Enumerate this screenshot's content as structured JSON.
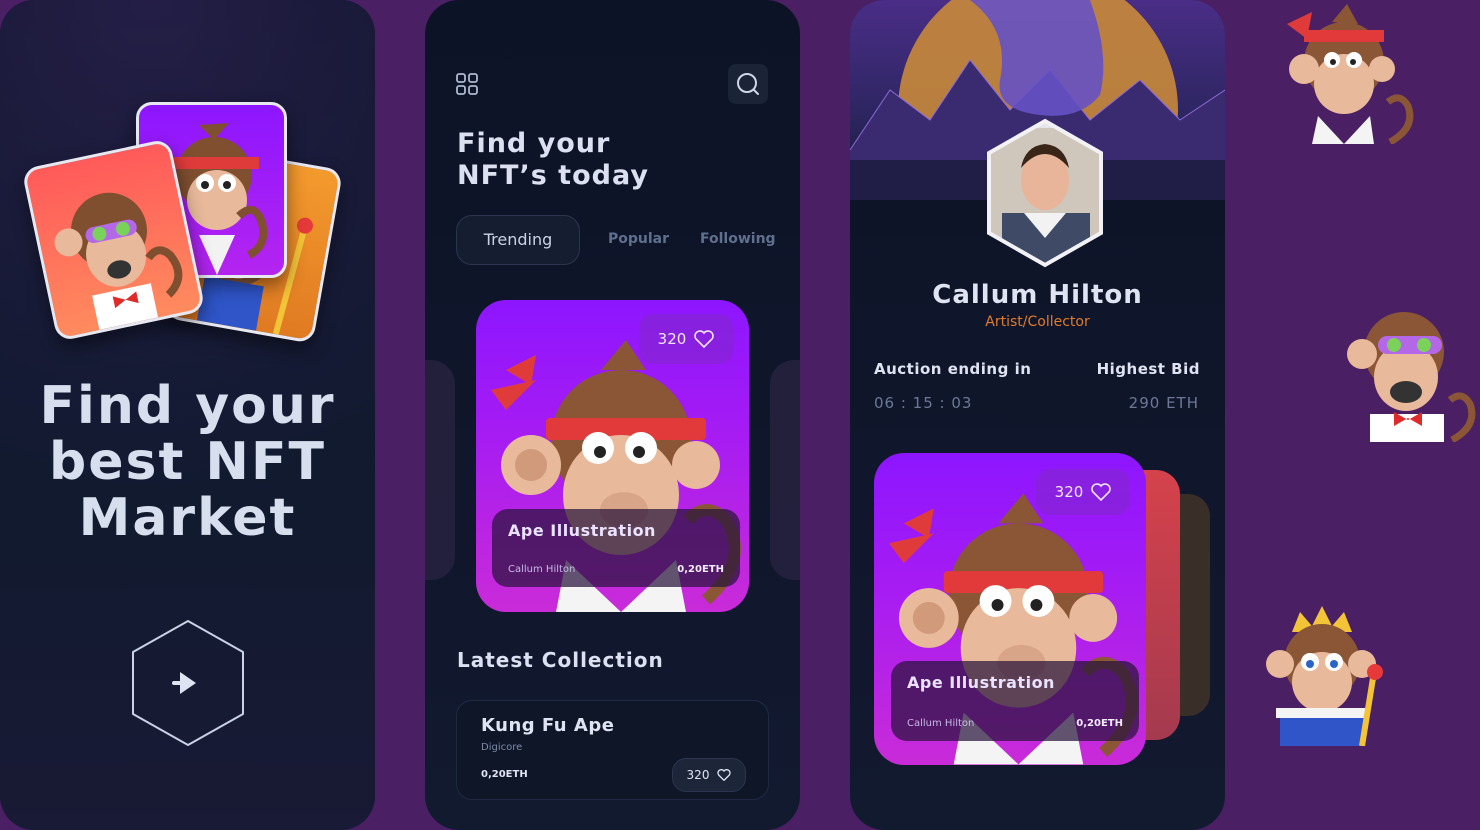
{
  "screen1": {
    "hero_title_lines": [
      "Find your",
      "best NFT",
      "Market"
    ]
  },
  "screen2": {
    "heading_lines": [
      "Find your",
      "NFT’s today"
    ],
    "tabs": [
      {
        "label": "Trending",
        "active": true
      },
      {
        "label": "Popular",
        "active": false
      },
      {
        "label": "Following",
        "active": false
      }
    ],
    "featured": {
      "likes": "320",
      "title": "Ape Illustration",
      "author": "Callum Hilton",
      "price": "0,20ETH"
    },
    "latest_heading": "Latest Collection",
    "collection": {
      "title": "Kung Fu Ape",
      "creator": "Digicore",
      "price": "0,20ETH",
      "likes": "320"
    }
  },
  "screen3": {
    "profile_name": "Callum Hilton",
    "profile_role": "Artist/Collector",
    "auction_label": "Auction ending in",
    "auction_time": "06 : 15 : 03",
    "bid_label": "Highest Bid",
    "bid_value": "290 ETH",
    "card": {
      "likes": "320",
      "title": "Ape Illustration",
      "author": "Callum Hilton",
      "price": "0,20ETH"
    }
  },
  "colors": {
    "background": "#4a1f63",
    "phone": "#0d1326",
    "accent_purple": "#8d16ff",
    "accent_orange": "#e07a2e",
    "text": "#dfe4f2"
  },
  "icons": [
    "grid-icon",
    "search-icon",
    "heart-icon",
    "play-icon"
  ]
}
